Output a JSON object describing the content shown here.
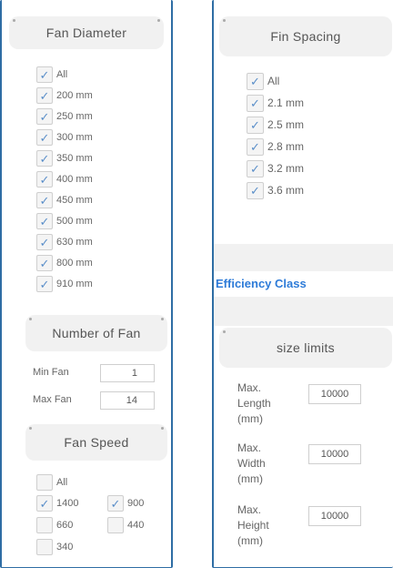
{
  "fan_diameter": {
    "title": "Fan Diameter",
    "options": [
      {
        "label": "All",
        "checked": true
      },
      {
        "label": "200 mm",
        "checked": true
      },
      {
        "label": "250 mm",
        "checked": true
      },
      {
        "label": "300 mm",
        "checked": true
      },
      {
        "label": "350 mm",
        "checked": true
      },
      {
        "label": "400 mm",
        "checked": true
      },
      {
        "label": "450 mm",
        "checked": true
      },
      {
        "label": "500 mm",
        "checked": true
      },
      {
        "label": "630 mm",
        "checked": true
      },
      {
        "label": "800 mm",
        "checked": true
      },
      {
        "label": "910 mm",
        "checked": true
      }
    ]
  },
  "number_of_fan": {
    "title": "Number of Fan",
    "min_label": "Min Fan",
    "min_value": "1",
    "max_label": "Max Fan",
    "max_value": "14"
  },
  "fan_speed": {
    "title": "Fan Speed",
    "options": [
      {
        "label": "All",
        "checked": false
      },
      {
        "label": "1400",
        "checked": true
      },
      {
        "label": "900",
        "checked": true
      },
      {
        "label": "660",
        "checked": false
      },
      {
        "label": "440",
        "checked": false
      },
      {
        "label": "340",
        "checked": false
      }
    ]
  },
  "fin_spacing": {
    "title": "Fin Spacing",
    "options": [
      {
        "label": "All",
        "checked": true
      },
      {
        "label": "2.1 mm",
        "checked": true
      },
      {
        "label": "2.5 mm",
        "checked": true
      },
      {
        "label": "2.8 mm",
        "checked": true
      },
      {
        "label": "3.2 mm",
        "checked": true
      },
      {
        "label": "3.6 mm",
        "checked": true
      }
    ]
  },
  "efficiency_class": {
    "label": "Efficiency Class"
  },
  "size_limits": {
    "title": "size limits",
    "fields": [
      {
        "label_lines": [
          "Max.",
          "Length",
          "(mm)"
        ],
        "value": "10000"
      },
      {
        "label_lines": [
          "Max.",
          "Width",
          "(mm)"
        ],
        "value": "10000"
      },
      {
        "label_lines": [
          "Max.",
          "Height",
          "(mm)"
        ],
        "value": "10000"
      }
    ]
  },
  "colors": {
    "panel_border": "#2e6da4",
    "header_bg": "#f1f1f1",
    "link": "#2d7bd8",
    "checkmark": "#5b8fc9"
  },
  "icons": {
    "checkmark": "check-icon"
  }
}
